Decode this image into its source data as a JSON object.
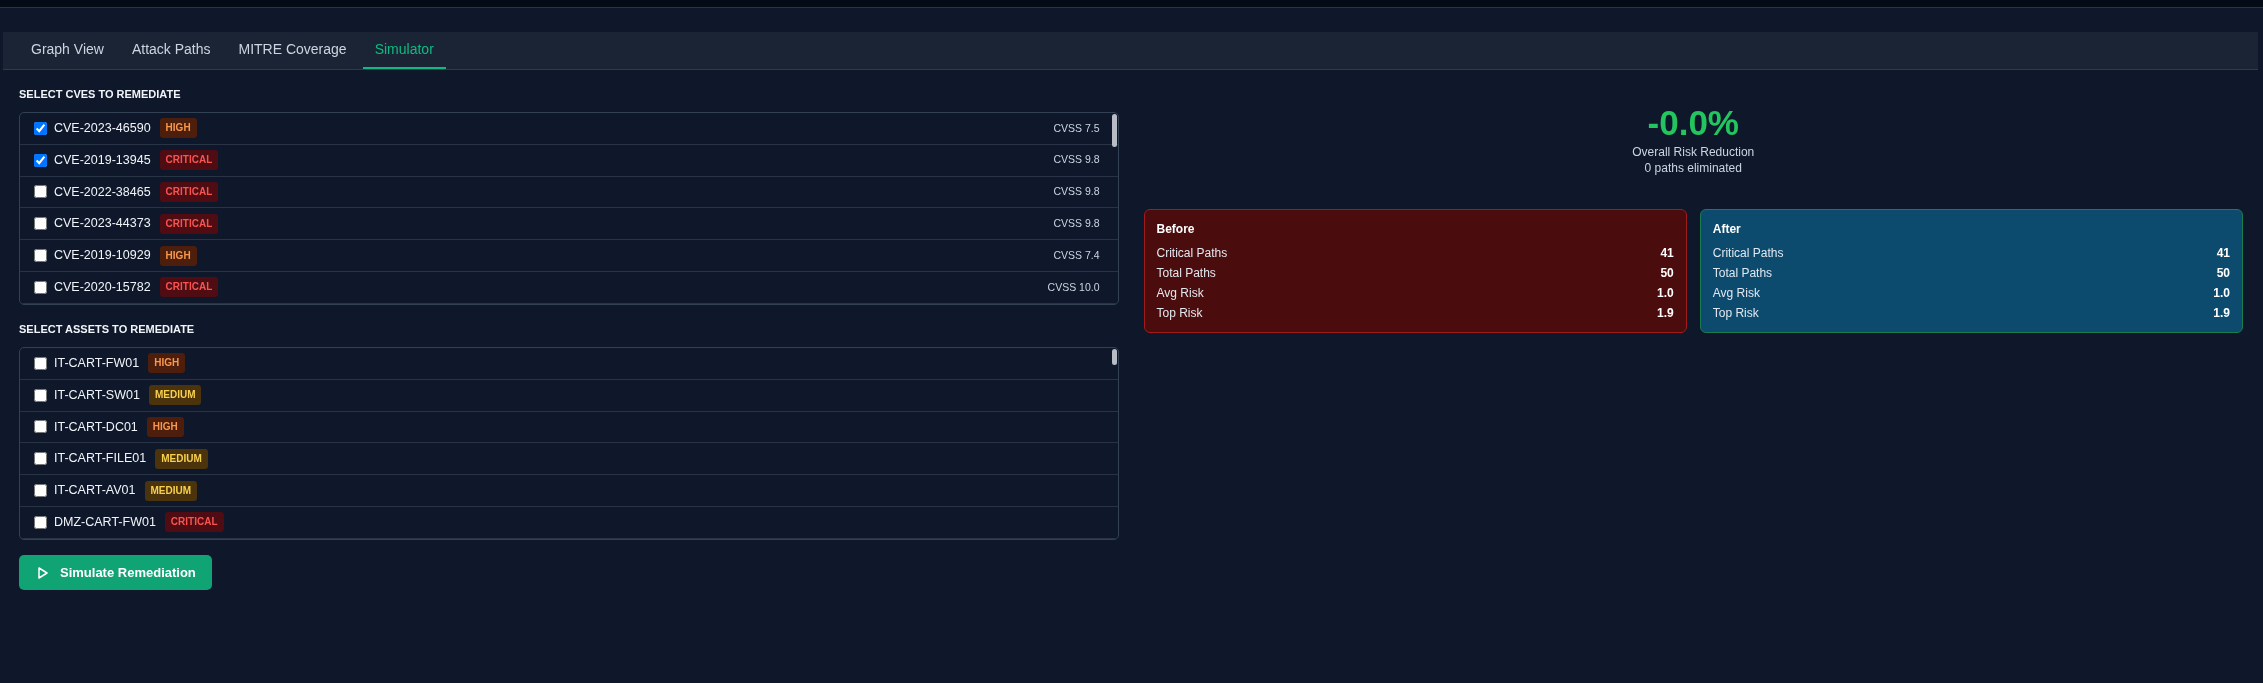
{
  "tabs": [
    {
      "label": "Graph View",
      "selected": false
    },
    {
      "label": "Attack Paths",
      "selected": false
    },
    {
      "label": "MITRE Coverage",
      "selected": false
    },
    {
      "label": "Simulator",
      "selected": true
    }
  ],
  "cve_selection": {
    "title": "SELECT CVES TO REMEDIATE",
    "items": [
      {
        "label": "CVE-2023-46590",
        "badge": {
          "text": "HIGH",
          "color": "#4c1e0b"
        },
        "score": "CVSS 7.5",
        "checked": true
      },
      {
        "label": "CVE-2019-13945",
        "badge": {
          "text": "CRITICAL",
          "color": "#4f0c13"
        },
        "score": "CVSS 9.8",
        "checked": true
      },
      {
        "label": "CVE-2022-38465",
        "badge": {
          "text": "CRITICAL",
          "color": "#4f0c13"
        },
        "score": "CVSS 9.8",
        "checked": false
      },
      {
        "label": "CVE-2023-44373",
        "badge": {
          "text": "CRITICAL",
          "color": "#4f0c13"
        },
        "score": "CVSS 9.8",
        "checked": false
      },
      {
        "label": "CVE-2019-10929",
        "badge": {
          "text": "HIGH",
          "color": "#4c1e0b"
        },
        "score": "CVSS 7.4",
        "checked": false
      },
      {
        "label": "CVE-2020-15782",
        "badge": {
          "text": "CRITICAL",
          "color": "#4f0c13"
        },
        "score": "CVSS 10.0",
        "checked": false
      }
    ]
  },
  "asset_selection": {
    "title": "SELECT ASSETS TO REMEDIATE",
    "items": [
      {
        "label": "IT-CART-FW01",
        "badge": {
          "text": "HIGH",
          "color": "#4c1e0b"
        },
        "checked": false
      },
      {
        "label": "IT-CART-SW01",
        "badge": {
          "text": "MEDIUM",
          "color": "#4b340b"
        },
        "checked": false
      },
      {
        "label": "IT-CART-DC01",
        "badge": {
          "text": "HIGH",
          "color": "#4c1e0b"
        },
        "checked": false
      },
      {
        "label": "IT-CART-FILE01",
        "badge": {
          "text": "MEDIUM",
          "color": "#4b340b"
        },
        "checked": false
      },
      {
        "label": "IT-CART-AV01",
        "badge": {
          "text": "MEDIUM",
          "color": "#4b340b"
        },
        "checked": false
      },
      {
        "label": "DMZ-CART-FW01",
        "badge": {
          "text": "CRITICAL",
          "color": "#4f0c13"
        },
        "checked": false
      }
    ]
  },
  "simulate_button": {
    "label": "Simulate Remediation"
  },
  "summary": {
    "value": "-0.0%",
    "label": "Overall Risk Reduction",
    "detail": "0 paths eliminated"
  },
  "comparison": [
    {
      "kind": "before",
      "title": "Before",
      "metrics": [
        {
          "label": "Critical Paths",
          "value": "41"
        },
        {
          "label": "Total Paths",
          "value": "50"
        },
        {
          "label": "Avg Risk",
          "value": "1.0"
        },
        {
          "label": "Top Risk",
          "value": "1.9"
        }
      ]
    },
    {
      "kind": "after",
      "title": "After",
      "metrics": [
        {
          "label": "Critical Paths",
          "value": "41"
        },
        {
          "label": "Total Paths",
          "value": "50"
        },
        {
          "label": "Avg Risk",
          "value": "1.0"
        },
        {
          "label": "Top Risk",
          "value": "1.9"
        }
      ]
    }
  ]
}
